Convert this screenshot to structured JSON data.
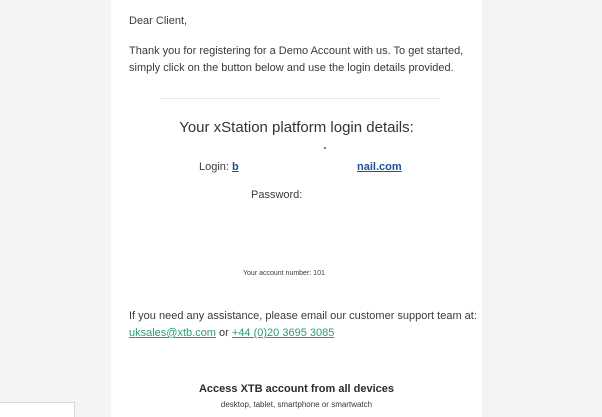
{
  "email": {
    "greeting": "Dear Client,",
    "intro": "Thank you for registering for a Demo Account with us. To get started, simply click on the button below and use the login details provided.",
    "login_title": "Your xStation platform login details:",
    "login_label": "Login:",
    "login_value_start": "b",
    "login_value_end": "nail.com",
    "password_label": "Password:",
    "account_number_text": "Your account number: 101",
    "assist_text": "If you need any assistance, please email our customer support team at:",
    "support_email": "uksales@xtb.com",
    "or_text": "or",
    "support_phone": "+44 (0)20 3695 3085",
    "access_title": "Access XTB account from all devices",
    "access_subtitle": "desktop, tablet, smartphone or smartwatch"
  },
  "colors": {
    "link_blue": "#1f4e9c",
    "link_green": "#2a9a7a",
    "background": "#f4f4f4"
  }
}
